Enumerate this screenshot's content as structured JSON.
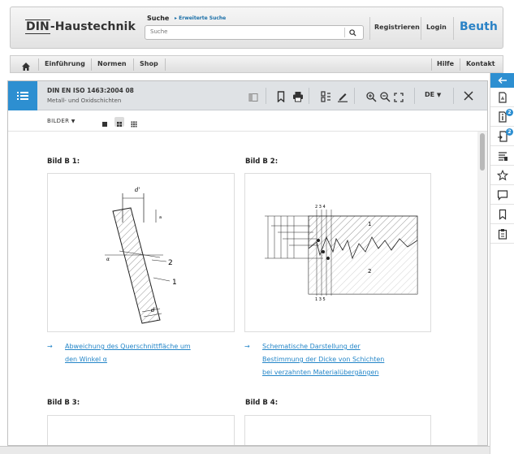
{
  "header": {
    "brand": "DIN-Haustechnik",
    "brand_din": "DIN",
    "brand_rest": "-Haustechnik",
    "search_label": "Suche",
    "advanced_search": "Erweiterte Suche",
    "search_placeholder": "Suche",
    "register": "Registrieren",
    "login": "Login",
    "publisher": "Beuth"
  },
  "nav": {
    "items": [
      "Einführung",
      "Normen",
      "Shop"
    ],
    "right": [
      "Hilfe",
      "Kontakt"
    ]
  },
  "document": {
    "title": "DIN EN ISO 1463:2004 08",
    "subtitle": "Metall- und Oxidschichten",
    "language": "DE",
    "view_mode": "BILDER"
  },
  "figures": [
    {
      "title": "Bild B 1:",
      "caption": [
        "Abweichung des Querschnittfläche um",
        "den Winkel α"
      ]
    },
    {
      "title": "Bild B 2:",
      "caption": [
        "Schematische Darstellung der",
        "Bestimmung der Dicke von Schichten",
        "bei verzahnten Materialübergängen"
      ]
    },
    {
      "title": "Bild B 3:"
    },
    {
      "title": "Bild B 4:"
    }
  ],
  "sidebar": {
    "badges": [
      "2",
      "2"
    ]
  },
  "colors": {
    "accent": "#2d8fd1",
    "link": "#2486c8"
  }
}
